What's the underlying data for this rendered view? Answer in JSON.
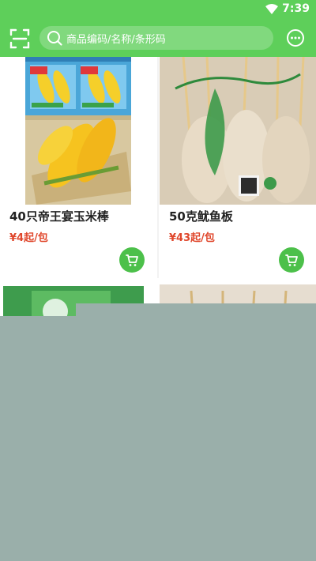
{
  "status_bar": {
    "time": "7:39",
    "icons": [
      "wifi-icon"
    ]
  },
  "header": {
    "scan_icon": "scan-icon",
    "search": {
      "placeholder": "商品编码/名称/条形码",
      "icon": "search-icon"
    },
    "message_icon": "chat-icon"
  },
  "products": [
    {
      "title": "40只帝王宴玉米棒",
      "price": "¥4起/包",
      "image": "corn-image",
      "cart_icon": "cart-icon"
    },
    {
      "title": "50克鱿鱼板",
      "price": "¥43起/包",
      "image": "squid-image",
      "cart_icon": "cart-icon"
    }
  ],
  "colors": {
    "brand_green": "#5ecf5a",
    "price_red": "#e0472c",
    "cart_green": "#4cc04a",
    "overlay": "#9aafaa"
  }
}
